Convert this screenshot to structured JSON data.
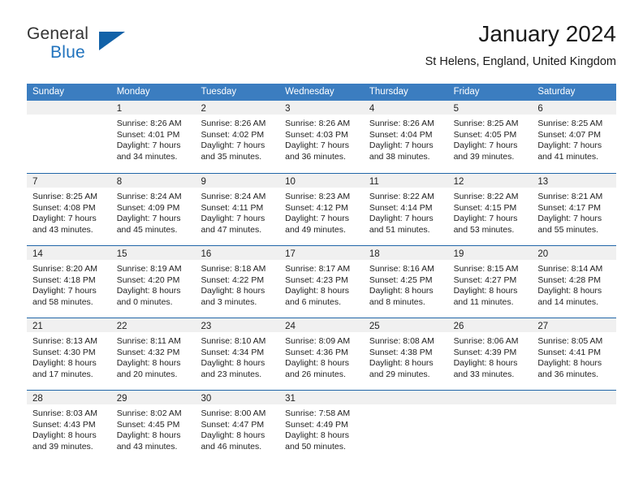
{
  "brand": {
    "general": "General",
    "blue": "Blue",
    "triangle_color": "#1262a8"
  },
  "header": {
    "title": "January 2024",
    "location": "St Helens, England, United Kingdom"
  },
  "colors": {
    "header_blue": "#3b7dc0",
    "row_rule_blue": "#2166a8",
    "day_band_gray": "#f0f0f0",
    "text": "#222222"
  },
  "weekdays": [
    "Sunday",
    "Monday",
    "Tuesday",
    "Wednesday",
    "Thursday",
    "Friday",
    "Saturday"
  ],
  "weeks": [
    [
      {
        "day": "",
        "sunrise": "",
        "sunset": "",
        "daylight1": "",
        "daylight2": "",
        "empty": true
      },
      {
        "day": "1",
        "sunrise": "Sunrise: 8:26 AM",
        "sunset": "Sunset: 4:01 PM",
        "daylight1": "Daylight: 7 hours",
        "daylight2": "and 34 minutes."
      },
      {
        "day": "2",
        "sunrise": "Sunrise: 8:26 AM",
        "sunset": "Sunset: 4:02 PM",
        "daylight1": "Daylight: 7 hours",
        "daylight2": "and 35 minutes."
      },
      {
        "day": "3",
        "sunrise": "Sunrise: 8:26 AM",
        "sunset": "Sunset: 4:03 PM",
        "daylight1": "Daylight: 7 hours",
        "daylight2": "and 36 minutes."
      },
      {
        "day": "4",
        "sunrise": "Sunrise: 8:26 AM",
        "sunset": "Sunset: 4:04 PM",
        "daylight1": "Daylight: 7 hours",
        "daylight2": "and 38 minutes."
      },
      {
        "day": "5",
        "sunrise": "Sunrise: 8:25 AM",
        "sunset": "Sunset: 4:05 PM",
        "daylight1": "Daylight: 7 hours",
        "daylight2": "and 39 minutes."
      },
      {
        "day": "6",
        "sunrise": "Sunrise: 8:25 AM",
        "sunset": "Sunset: 4:07 PM",
        "daylight1": "Daylight: 7 hours",
        "daylight2": "and 41 minutes."
      }
    ],
    [
      {
        "day": "7",
        "sunrise": "Sunrise: 8:25 AM",
        "sunset": "Sunset: 4:08 PM",
        "daylight1": "Daylight: 7 hours",
        "daylight2": "and 43 minutes."
      },
      {
        "day": "8",
        "sunrise": "Sunrise: 8:24 AM",
        "sunset": "Sunset: 4:09 PM",
        "daylight1": "Daylight: 7 hours",
        "daylight2": "and 45 minutes."
      },
      {
        "day": "9",
        "sunrise": "Sunrise: 8:24 AM",
        "sunset": "Sunset: 4:11 PM",
        "daylight1": "Daylight: 7 hours",
        "daylight2": "and 47 minutes."
      },
      {
        "day": "10",
        "sunrise": "Sunrise: 8:23 AM",
        "sunset": "Sunset: 4:12 PM",
        "daylight1": "Daylight: 7 hours",
        "daylight2": "and 49 minutes."
      },
      {
        "day": "11",
        "sunrise": "Sunrise: 8:22 AM",
        "sunset": "Sunset: 4:14 PM",
        "daylight1": "Daylight: 7 hours",
        "daylight2": "and 51 minutes."
      },
      {
        "day": "12",
        "sunrise": "Sunrise: 8:22 AM",
        "sunset": "Sunset: 4:15 PM",
        "daylight1": "Daylight: 7 hours",
        "daylight2": "and 53 minutes."
      },
      {
        "day": "13",
        "sunrise": "Sunrise: 8:21 AM",
        "sunset": "Sunset: 4:17 PM",
        "daylight1": "Daylight: 7 hours",
        "daylight2": "and 55 minutes."
      }
    ],
    [
      {
        "day": "14",
        "sunrise": "Sunrise: 8:20 AM",
        "sunset": "Sunset: 4:18 PM",
        "daylight1": "Daylight: 7 hours",
        "daylight2": "and 58 minutes."
      },
      {
        "day": "15",
        "sunrise": "Sunrise: 8:19 AM",
        "sunset": "Sunset: 4:20 PM",
        "daylight1": "Daylight: 8 hours",
        "daylight2": "and 0 minutes."
      },
      {
        "day": "16",
        "sunrise": "Sunrise: 8:18 AM",
        "sunset": "Sunset: 4:22 PM",
        "daylight1": "Daylight: 8 hours",
        "daylight2": "and 3 minutes."
      },
      {
        "day": "17",
        "sunrise": "Sunrise: 8:17 AM",
        "sunset": "Sunset: 4:23 PM",
        "daylight1": "Daylight: 8 hours",
        "daylight2": "and 6 minutes."
      },
      {
        "day": "18",
        "sunrise": "Sunrise: 8:16 AM",
        "sunset": "Sunset: 4:25 PM",
        "daylight1": "Daylight: 8 hours",
        "daylight2": "and 8 minutes."
      },
      {
        "day": "19",
        "sunrise": "Sunrise: 8:15 AM",
        "sunset": "Sunset: 4:27 PM",
        "daylight1": "Daylight: 8 hours",
        "daylight2": "and 11 minutes."
      },
      {
        "day": "20",
        "sunrise": "Sunrise: 8:14 AM",
        "sunset": "Sunset: 4:28 PM",
        "daylight1": "Daylight: 8 hours",
        "daylight2": "and 14 minutes."
      }
    ],
    [
      {
        "day": "21",
        "sunrise": "Sunrise: 8:13 AM",
        "sunset": "Sunset: 4:30 PM",
        "daylight1": "Daylight: 8 hours",
        "daylight2": "and 17 minutes."
      },
      {
        "day": "22",
        "sunrise": "Sunrise: 8:11 AM",
        "sunset": "Sunset: 4:32 PM",
        "daylight1": "Daylight: 8 hours",
        "daylight2": "and 20 minutes."
      },
      {
        "day": "23",
        "sunrise": "Sunrise: 8:10 AM",
        "sunset": "Sunset: 4:34 PM",
        "daylight1": "Daylight: 8 hours",
        "daylight2": "and 23 minutes."
      },
      {
        "day": "24",
        "sunrise": "Sunrise: 8:09 AM",
        "sunset": "Sunset: 4:36 PM",
        "daylight1": "Daylight: 8 hours",
        "daylight2": "and 26 minutes."
      },
      {
        "day": "25",
        "sunrise": "Sunrise: 8:08 AM",
        "sunset": "Sunset: 4:38 PM",
        "daylight1": "Daylight: 8 hours",
        "daylight2": "and 29 minutes."
      },
      {
        "day": "26",
        "sunrise": "Sunrise: 8:06 AM",
        "sunset": "Sunset: 4:39 PM",
        "daylight1": "Daylight: 8 hours",
        "daylight2": "and 33 minutes."
      },
      {
        "day": "27",
        "sunrise": "Sunrise: 8:05 AM",
        "sunset": "Sunset: 4:41 PM",
        "daylight1": "Daylight: 8 hours",
        "daylight2": "and 36 minutes."
      }
    ],
    [
      {
        "day": "28",
        "sunrise": "Sunrise: 8:03 AM",
        "sunset": "Sunset: 4:43 PM",
        "daylight1": "Daylight: 8 hours",
        "daylight2": "and 39 minutes."
      },
      {
        "day": "29",
        "sunrise": "Sunrise: 8:02 AM",
        "sunset": "Sunset: 4:45 PM",
        "daylight1": "Daylight: 8 hours",
        "daylight2": "and 43 minutes."
      },
      {
        "day": "30",
        "sunrise": "Sunrise: 8:00 AM",
        "sunset": "Sunset: 4:47 PM",
        "daylight1": "Daylight: 8 hours",
        "daylight2": "and 46 minutes."
      },
      {
        "day": "31",
        "sunrise": "Sunrise: 7:58 AM",
        "sunset": "Sunset: 4:49 PM",
        "daylight1": "Daylight: 8 hours",
        "daylight2": "and 50 minutes."
      },
      {
        "day": "",
        "sunrise": "",
        "sunset": "",
        "daylight1": "",
        "daylight2": "",
        "empty": true
      },
      {
        "day": "",
        "sunrise": "",
        "sunset": "",
        "daylight1": "",
        "daylight2": "",
        "empty": true
      },
      {
        "day": "",
        "sunrise": "",
        "sunset": "",
        "daylight1": "",
        "daylight2": "",
        "empty": true
      }
    ]
  ]
}
